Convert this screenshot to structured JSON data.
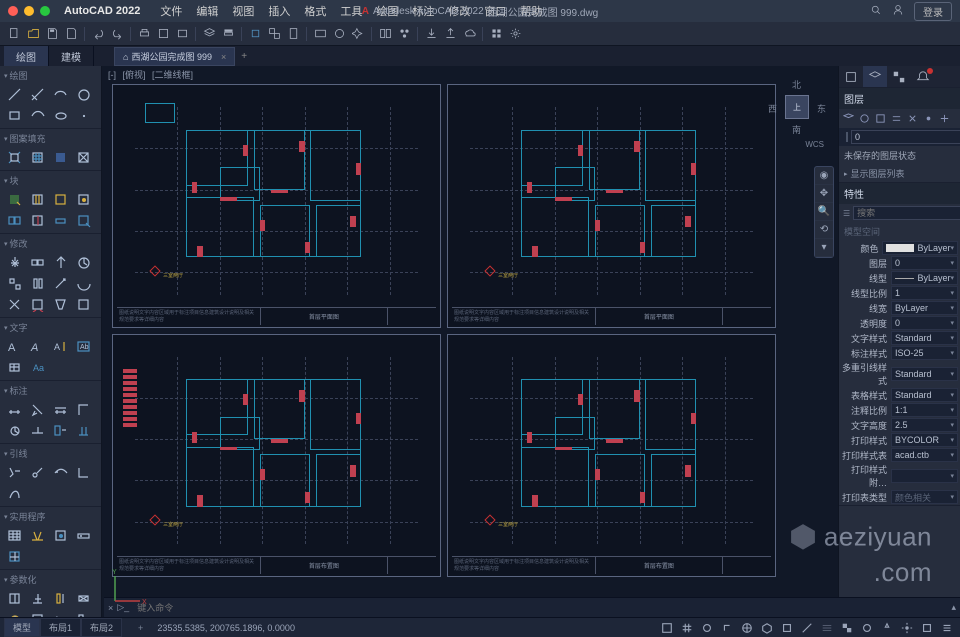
{
  "app": {
    "title": "AutoCAD 2022",
    "center_app": "Autodesk AutoCAD 2022",
    "center_file": "西湖公园完成图 999.dwg",
    "login": "登录"
  },
  "menu": [
    "文件",
    "编辑",
    "视图",
    "插入",
    "格式",
    "工具",
    "绘图",
    "标注",
    "修改",
    "窗口",
    "帮助"
  ],
  "ribbon_tabs": [
    "绘图",
    "建模"
  ],
  "file_tab": "西湖公园完成图 999",
  "crumb": [
    "[-]",
    "[俯视]",
    "[二维线框]"
  ],
  "viewcube": {
    "top": "上",
    "n": "北",
    "s": "南",
    "e": "东",
    "w": "西",
    "wcs": "WCS"
  },
  "tool_groups": [
    "绘图",
    "图案填充",
    "块",
    "修改",
    "文字",
    "标注",
    "引线",
    "实用程序",
    "参数化"
  ],
  "right": {
    "layer_header": "图层",
    "layer_current": "0",
    "unsaved": "未保存的图层状态",
    "show_list": "显示图层列表",
    "props_header": "特性",
    "search": "搜索",
    "no_sel": "模型空间"
  },
  "props": [
    {
      "k": "颜色",
      "v": "ByLayer",
      "sw": true
    },
    {
      "k": "图层",
      "v": "0"
    },
    {
      "k": "线型",
      "v": "ByLayer",
      "line": true
    },
    {
      "k": "线型比例",
      "v": "1"
    },
    {
      "k": "线宽",
      "v": "ByLayer"
    },
    {
      "k": "透明度",
      "v": "0"
    },
    {
      "k": "文字样式",
      "v": "Standard"
    },
    {
      "k": "标注样式",
      "v": "ISO-25"
    },
    {
      "k": "多重引线样式",
      "v": "Standard"
    },
    {
      "k": "表格样式",
      "v": "Standard"
    },
    {
      "k": "注释比例",
      "v": "1:1"
    },
    {
      "k": "文字高度",
      "v": "2.5"
    },
    {
      "k": "打印样式",
      "v": "BYCOLOR"
    },
    {
      "k": "打印样式表",
      "v": "acad.ctb"
    },
    {
      "k": "打印样式附…",
      "v": "",
      "dim": true
    },
    {
      "k": "打印表类型",
      "v": "颜色相关",
      "dim": true
    }
  ],
  "sheets": [
    {
      "title": "首层平面图",
      "note": "三室两厅"
    },
    {
      "title": "首层平面图",
      "note": "三室两厅"
    },
    {
      "title": "首层布置图",
      "note": "三室两厅"
    },
    {
      "title": "首层布置图",
      "note": "三室两厅"
    }
  ],
  "cmd_placeholder": "键入命令",
  "status_tabs": [
    "模型",
    "布局1",
    "布局2"
  ],
  "coords": "23535.5385, 200765.1896, 0.0000",
  "watermark": {
    "a": "aeziyuan",
    "b": ".com"
  }
}
